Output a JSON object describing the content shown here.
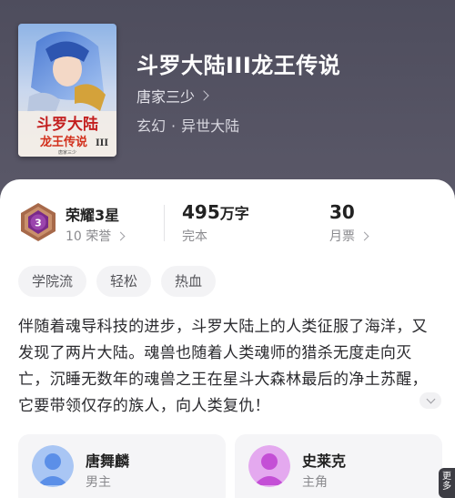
{
  "book": {
    "title": "斗罗大陆III龙王传说",
    "author": "唐家三少",
    "genre_primary": "玄幻",
    "genre_separator": "·",
    "genre_secondary": "异世大陆"
  },
  "cover": {
    "title_line1": "斗罗大陆",
    "title_line2": "龙王传说",
    "title_roman": "III",
    "author_text": "唐家三少"
  },
  "stats": {
    "honor": {
      "level_number": "3",
      "title": "荣耀3星",
      "sub": "10 荣誉"
    },
    "words": {
      "value": "495",
      "unit": "万字",
      "label": "完本"
    },
    "votes": {
      "value": "30",
      "label": "月票"
    }
  },
  "tags": [
    "学院流",
    "轻松",
    "热血"
  ],
  "synopsis": "伴随着魂导科技的进步，斗罗大陆上的人类征服了海洋，又发现了两片大陆。魂兽也随着人类魂师的猎杀无度走向灭亡，沉睡无数年的魂兽之王在星斗大森林最后的净土苏醒，它要带领仅存的族人，向人类复仇！",
  "characters": [
    {
      "name": "唐舞麟",
      "role": "男主",
      "avatar_color": "#5b8fe8"
    },
    {
      "name": "史莱克",
      "role": "主角",
      "avatar_color": "#c44fd6"
    }
  ],
  "side_tab": {
    "label": "更多"
  },
  "colors": {
    "header_bg": "#4e4d5d",
    "badge_purple": "#7a2a8a",
    "badge_bronze": "#a7694a"
  },
  "icons": {
    "author_chevron": "chevron-right-icon",
    "expand": "chevron-down-icon"
  }
}
